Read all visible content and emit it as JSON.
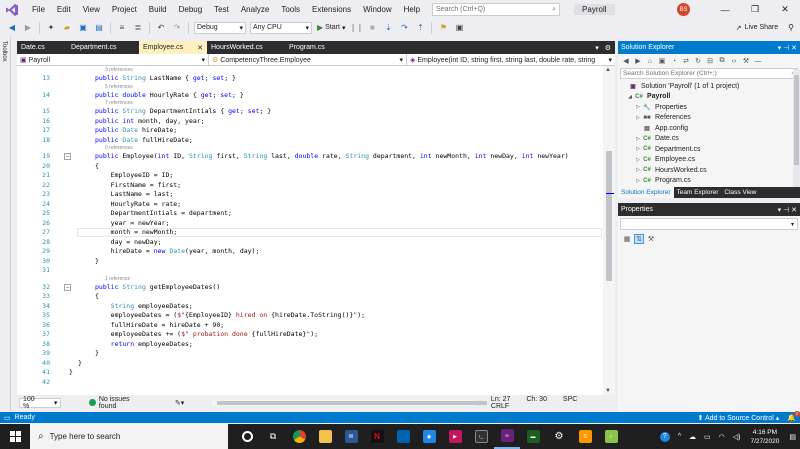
{
  "menu": {
    "items": [
      "File",
      "Edit",
      "View",
      "Project",
      "Build",
      "Debug",
      "Test",
      "Analyze",
      "Tools",
      "Extensions",
      "Window",
      "Help"
    ],
    "search_placeholder": "Search (Ctrl+Q)",
    "solution_name": "Payroll",
    "avatar_initials": "BS"
  },
  "toolbar": {
    "config": "Debug",
    "platform": "Any CPU",
    "start_label": "Start",
    "live_share": "Live Share"
  },
  "toolbox_label": "Toolbox",
  "tabs": [
    {
      "label": "Date.cs",
      "active": false
    },
    {
      "label": "Department.cs",
      "active": false
    },
    {
      "label": "Employee.cs",
      "active": true
    },
    {
      "label": "HoursWorked.cs",
      "active": false
    },
    {
      "label": "Program.cs",
      "active": false
    }
  ],
  "nav": {
    "project": "Payroll",
    "class": "CompetencyThree.Employee",
    "member": "Employee(int ID, string first, string last, double rate, string"
  },
  "code_lines": [
    {
      "n": "13",
      "refs": "3 references",
      "html": "<span class='kw'>public</span> <span class='ty'>String</span> LastName { <span class='kw'>get</span>; <span class='kw'>set</span>; }"
    },
    {
      "n": "14",
      "refs": "5 references",
      "html": "<span class='kw'>public</span> <span class='kw'>double</span> HourlyRate { <span class='kw'>get</span>; <span class='kw'>set</span>; }"
    },
    {
      "n": "15",
      "refs": "7 references",
      "html": "<span class='kw'>public</span> <span class='ty'>String</span> DepartmentIntials { <span class='kw'>get</span>; <span class='kw'>set</span>; }"
    },
    {
      "n": "16",
      "refs": "",
      "html": "<span class='kw'>public</span> <span class='kw'>int</span> month, day, year;"
    },
    {
      "n": "17",
      "refs": "",
      "html": "<span class='kw'>public</span> <span class='ty'>Date</span> hireDate;"
    },
    {
      "n": "18",
      "refs": "",
      "html": "<span class='kw'>public</span> <span class='ty'>Date</span> fullHireDate;"
    },
    {
      "n": "19",
      "refs": "0 references",
      "html": "<span class='kw'>public</span> Employee(<span class='kw'>int</span> ID, <span class='ty'>String</span> first, <span class='ty'>String</span> last, <span class='kw'>double</span> rate, <span class='ty'>String</span> department, <span class='kw'>int</span> newMonth, <span class='kw'>int</span> newDay, <span class='kw'>int</span> newYear)"
    },
    {
      "n": "20",
      "refs": "",
      "html": "{"
    },
    {
      "n": "21",
      "refs": "",
      "html": "    EmployeeID = ID;"
    },
    {
      "n": "22",
      "refs": "",
      "html": "    FirstName = first;"
    },
    {
      "n": "23",
      "refs": "",
      "html": "    LastName = last;"
    },
    {
      "n": "24",
      "refs": "",
      "html": "    HourlyRate = rate;"
    },
    {
      "n": "25",
      "refs": "",
      "html": "    DepartmentIntials = department;"
    },
    {
      "n": "26",
      "refs": "",
      "html": "    year = newYear;"
    },
    {
      "n": "27",
      "refs": "",
      "html": "    month = newMonth;"
    },
    {
      "n": "28",
      "refs": "",
      "html": "    day = newDay;"
    },
    {
      "n": "29",
      "refs": "",
      "html": "    hireDate = <span class='kw'>new</span> <span class='ty'>Date</span>(year, month, day);"
    },
    {
      "n": "30",
      "refs": "",
      "html": "}"
    },
    {
      "n": "31",
      "refs": "",
      "html": ""
    },
    {
      "n": "32",
      "refs": "1 reference",
      "html": "<span class='kw'>public</span> <span class='ty'>String</span> getEmployeeDates()"
    },
    {
      "n": "33",
      "refs": "",
      "html": "{"
    },
    {
      "n": "34",
      "refs": "",
      "html": "    <span class='ty'>String</span> employeeDates;"
    },
    {
      "n": "35",
      "refs": "",
      "html": "    employeeDates = (<span class='str'>$\"</span>{EmployeeID}<span class='str'> hired on </span>{hireDate.ToString()}<span class='str'>\"</span>);"
    },
    {
      "n": "36",
      "refs": "",
      "html": "    fullHireDate = hireDate + 90;"
    },
    {
      "n": "37",
      "refs": "",
      "html": "    employeeDates += (<span class='str'>$\" probation done </span>{fullHireDate}<span class='str'>\"</span>);"
    },
    {
      "n": "38",
      "refs": "",
      "html": "    <span class='kw'>return</span> employeeDates;"
    },
    {
      "n": "39",
      "refs": "",
      "html": "}"
    },
    {
      "n": "40",
      "refs": "",
      "html": "}"
    },
    {
      "n": "41",
      "refs": "",
      "html": "}"
    },
    {
      "n": "42",
      "refs": "",
      "html": ""
    }
  ],
  "editor_status": {
    "zoom": "100 %",
    "issues": "No issues found",
    "ln": "Ln: 27",
    "ch": "Ch: 30",
    "spc": "SPC",
    "crlf": "CRLF"
  },
  "solution_explorer": {
    "title": "Solution Explorer",
    "search_placeholder": "Search Solution Explorer (Ctrl+;)",
    "items": [
      {
        "label": "Solution 'Payroll' (1 of 1 project)",
        "icon": "solution-icon",
        "exp": ""
      },
      {
        "label": "Payroll",
        "icon": "csharp-project-icon",
        "exp": "◢",
        "bold": true
      },
      {
        "label": "Properties",
        "icon": "wrench-icon",
        "exp": "▷"
      },
      {
        "label": "References",
        "icon": "references-icon",
        "exp": "▷"
      },
      {
        "label": "App.config",
        "icon": "config-file-icon",
        "exp": ""
      },
      {
        "label": "Date.cs",
        "icon": "csharp-file-icon",
        "exp": "▷"
      },
      {
        "label": "Department.cs",
        "icon": "csharp-file-icon",
        "exp": "▷"
      },
      {
        "label": "Employee.cs",
        "icon": "csharp-file-icon",
        "exp": "▷"
      },
      {
        "label": "HoursWorked.cs",
        "icon": "csharp-file-icon",
        "exp": "▷"
      },
      {
        "label": "Program.cs",
        "icon": "csharp-file-icon",
        "exp": "▷"
      }
    ],
    "tabs": [
      "Solution Explorer",
      "Team Explorer",
      "Class View"
    ]
  },
  "properties": {
    "title": "Properties"
  },
  "statusbar": {
    "ready": "Ready",
    "source_control": "Add to Source Control",
    "notifications": "2"
  },
  "taskbar": {
    "search_placeholder": "Type here to search",
    "time": "4:16 PM",
    "date": "7/27/2020"
  }
}
